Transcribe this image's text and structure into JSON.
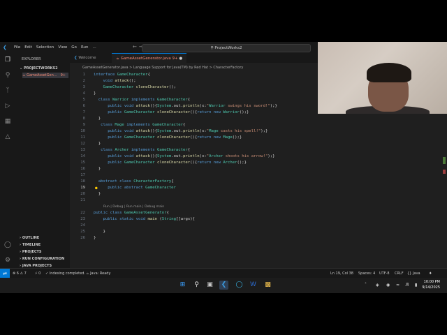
{
  "titlebar": {
    "menus": [
      "File",
      "Edit",
      "Selection",
      "View",
      "Go",
      "Run",
      "..."
    ],
    "search": "ProjectWorks2"
  },
  "sidebar": {
    "title": "EXPLORER",
    "project": "PROJECTWORKS2",
    "file": "GameAssetGen...",
    "file_badge": "9+",
    "sections": [
      "OUTLINE",
      "TIMELINE",
      "PROJECTS",
      "RUN CONFIGURATION",
      "JAVA PROJECTS"
    ]
  },
  "tabs": [
    {
      "label": "Welcome"
    },
    {
      "label": "GameAssetGenerator.java",
      "badge": "9+"
    }
  ],
  "breadcrumb": "GameAssetGenerator.java > Language Support for Java(TM) by Red Hat > CharacterFactory",
  "code_lens": "Run | Debug | Run main | Debug main",
  "code": [
    {
      "n": "1",
      "t": "interface GameCharacter{"
    },
    {
      "n": "2",
      "t": "    void attack();"
    },
    {
      "n": "3",
      "t": "    GameCharacter cloneCharacter();"
    },
    {
      "n": "4",
      "t": "}"
    },
    {
      "n": "5",
      "t": "  class Warrior implements GameCharacter{"
    },
    {
      "n": "6",
      "t": "      public void attack(){System.out.println(x:\"Warrior swings his sword!\");}"
    },
    {
      "n": "7",
      "t": "      public GameCharacter cloneCharacter(){return new Warrior();}"
    },
    {
      "n": "8",
      "t": "  }"
    },
    {
      "n": "9",
      "t": "   class Mage implements GameCharacter{"
    },
    {
      "n": "10",
      "t": "      public void attack(){System.out.println(x:\"Mage casts his spell!\");}"
    },
    {
      "n": "11",
      "t": "      public GameCharacter cloneCharacter(){return new Mage();}"
    },
    {
      "n": "12",
      "t": "  }"
    },
    {
      "n": "13",
      "t": "   class Archer implements GameCharacter{"
    },
    {
      "n": "14",
      "t": "      public void attack(){System.out.println(x:\"Archer shoots his arrow!\");}"
    },
    {
      "n": "15",
      "t": "      public GameCharacter cloneCharacter(){return new Archer();}"
    },
    {
      "n": "16",
      "t": "  }"
    },
    {
      "n": "17",
      "t": ""
    },
    {
      "n": "18",
      "t": "  abstract class CharacterFactory{"
    },
    {
      "n": "19",
      "t": "      public abstract GameCharacter"
    },
    {
      "n": "20",
      "t": "  }"
    },
    {
      "n": "21",
      "t": ""
    },
    {
      "n": "22",
      "t": "public class GameAssetGenerator{"
    },
    {
      "n": "23",
      "t": "    public static void main (String[]args){"
    },
    {
      "n": "24",
      "t": ""
    },
    {
      "n": "25",
      "t": "    }"
    },
    {
      "n": "26",
      "t": "}"
    }
  ],
  "status": {
    "errors": "6",
    "warnings": "7",
    "ports": "0",
    "indexing": "Indexing completed.",
    "java": "Java: Ready",
    "position": "Ln 19, Col 38",
    "spaces": "Spaces: 4",
    "encoding": "UTF-8",
    "eol": "CRLF",
    "language": "{} Java"
  },
  "clock": {
    "time": "10:00 PM",
    "date": "9/14/2025"
  },
  "colors": {
    "accent": "#0078d4",
    "error_file": "#f38b76"
  }
}
